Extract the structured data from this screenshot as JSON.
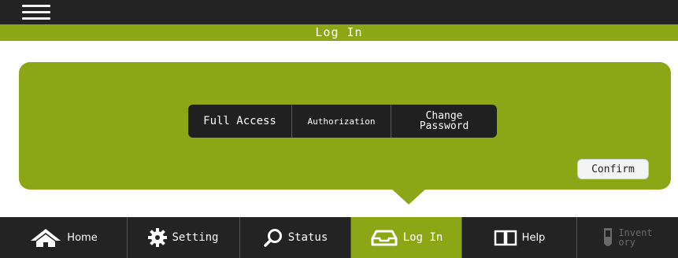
{
  "header": {
    "title": "Log In"
  },
  "login_options": {
    "full_access": "Full Access",
    "authorization": "Authorization",
    "change_password_line1": "Change",
    "change_password_line2": "Password"
  },
  "actions": {
    "confirm": "Confirm"
  },
  "nav": {
    "home": "Home",
    "setting": "Setting",
    "status": "Status",
    "login": "Log In",
    "help": "Help",
    "inventory_line1": "Invent",
    "inventory_line2": "ory"
  },
  "colors": {
    "accent": "#8ca616",
    "bar": "#232323"
  }
}
